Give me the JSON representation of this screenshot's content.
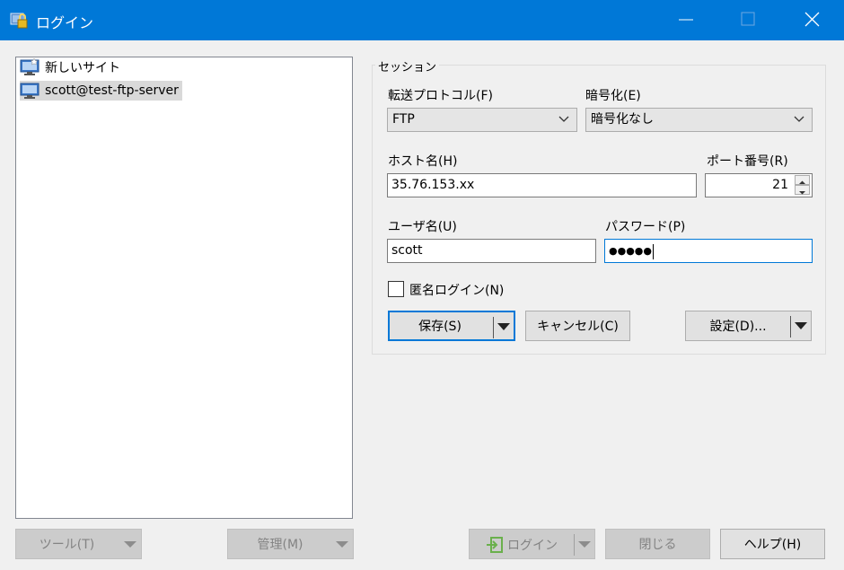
{
  "window": {
    "title": "ログイン",
    "icon": "lock-icon",
    "accent": "#0078d7"
  },
  "sites": [
    {
      "label": "新しいサイト",
      "icon": "new-site-monitor-icon",
      "selected": false
    },
    {
      "label": "scott@test-ftp-server",
      "icon": "site-monitor-icon",
      "selected": true
    }
  ],
  "session": {
    "title": "セッション",
    "protocol_label": "転送プロトコル(F)",
    "protocol_value": "FTP",
    "encryption_label": "暗号化(E)",
    "encryption_value": "暗号化なし",
    "host_label": "ホスト名(H)",
    "host_value": "35.76.153.xx",
    "port_label": "ポート番号(R)",
    "port_value": "21",
    "user_label": "ユーザ名(U)",
    "user_value": "scott",
    "password_label": "パスワード(P)",
    "password_value": "●●●●●",
    "anonymous_label": "匿名ログイン(N)",
    "anonymous_checked": false,
    "save_label": "保存(S)",
    "cancel_label": "キャンセル(C)",
    "settings_label": "設定(D)..."
  },
  "bottom": {
    "tools_label": "ツール(T)",
    "manage_label": "管理(M)",
    "login_label": "ログイン",
    "close_label": "閉じる",
    "help_label": "ヘルプ(H)"
  }
}
